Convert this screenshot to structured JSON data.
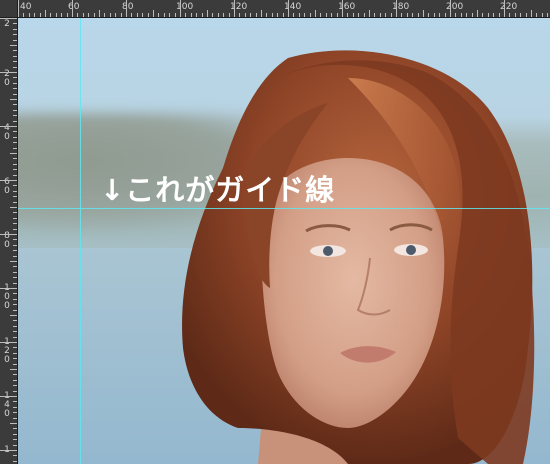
{
  "ruler": {
    "horizontal_labels": [
      "40",
      "60",
      "80",
      "100",
      "120",
      "140",
      "160",
      "180",
      "200",
      "220"
    ],
    "vertical_labels": [
      "2",
      "20",
      "40",
      "60",
      "80",
      "100",
      "120",
      "140",
      "1"
    ]
  },
  "annotation": {
    "text": "↓これがガイド線"
  },
  "colors": {
    "guide": "#5fe6f0",
    "ruler_bg": "#3b3b3b",
    "ruler_text": "#d6d6d6"
  }
}
